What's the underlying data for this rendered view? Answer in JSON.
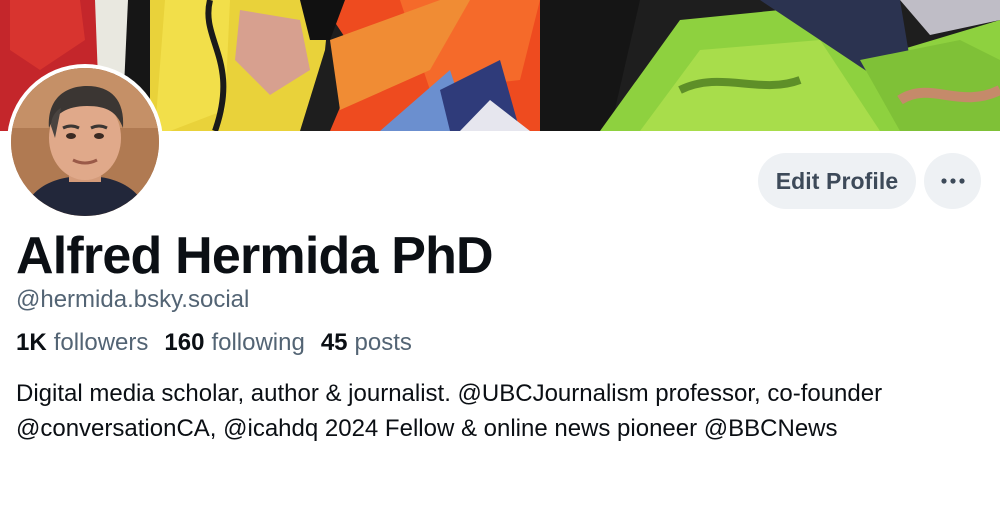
{
  "profile": {
    "display_name": "Alfred Hermida PhD",
    "handle": "@hermida.bsky.social",
    "bio": "Digital media scholar, author & journalist. @UBCJournalism professor, co-founder @conversationCA, @icahdq 2024 Fellow & online news pioneer @BBCNews"
  },
  "stats": {
    "followers_count": "1K",
    "followers_label": "followers",
    "following_count": "160",
    "following_label": "following",
    "posts_count": "45",
    "posts_label": "posts"
  },
  "actions": {
    "edit_profile_label": "Edit Profile",
    "more_icon": "ellipsis-icon"
  },
  "colors": {
    "button_bg": "#eef1f4",
    "secondary_text": "#536474",
    "primary_text": "#0b0f14"
  }
}
